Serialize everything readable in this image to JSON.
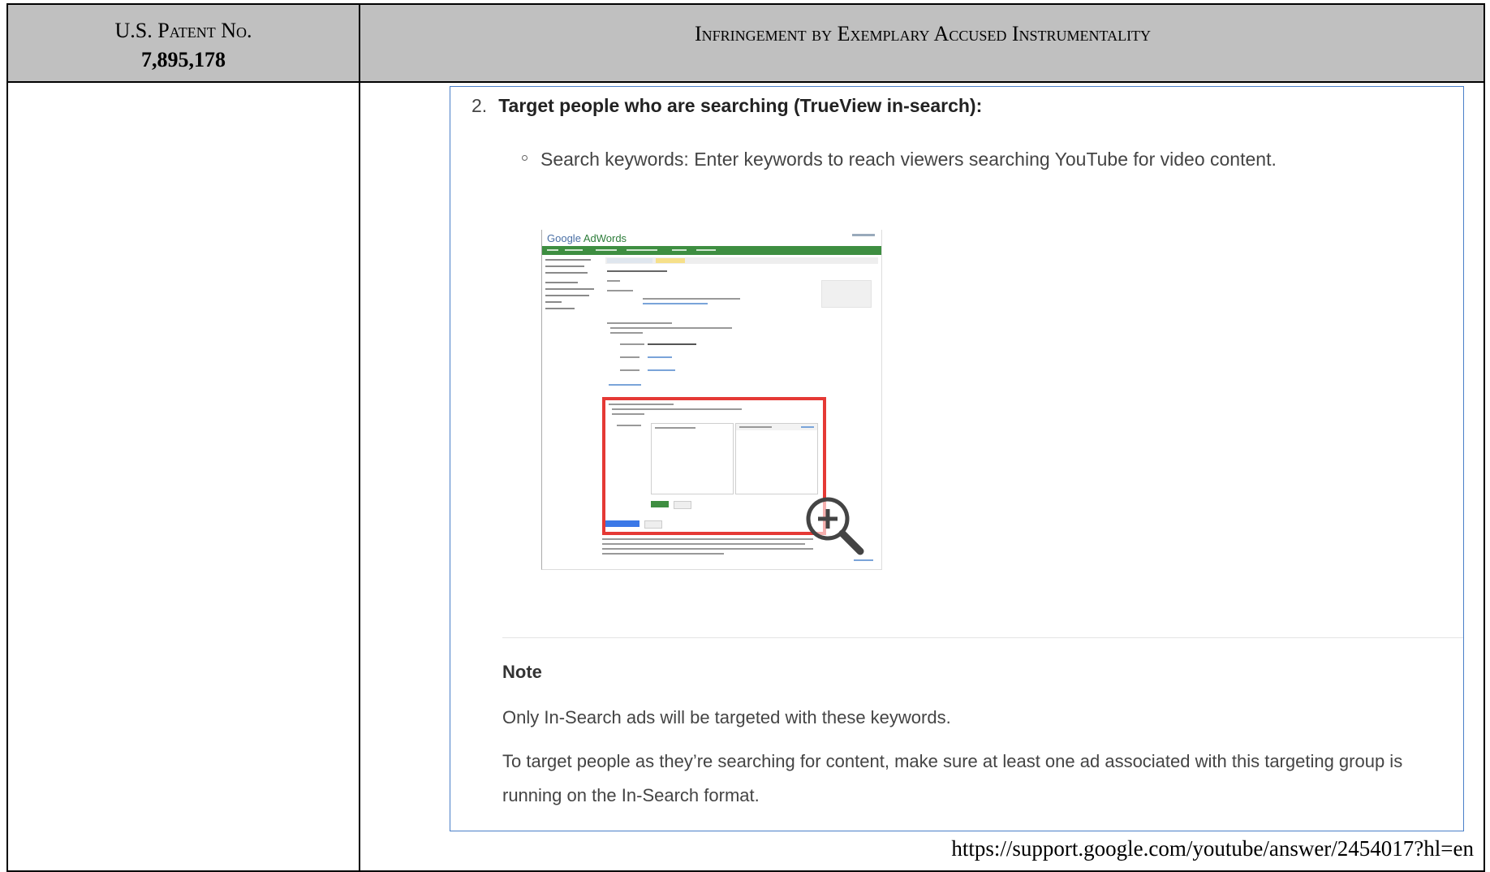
{
  "header": {
    "left_label": "U.S. Patent No.",
    "left_number": "7,895,178",
    "right_label": "Infringement by Exemplary Accused Instrumentality"
  },
  "content": {
    "step_number": "2.",
    "step_title": "Target people who are searching (TrueView in-search):",
    "bullet_text": "Search keywords: Enter keywords to reach viewers searching YouTube for video content.",
    "thumbnail": {
      "logo_google": "Google",
      "logo_adwords": "AdWords",
      "zoom_icon": "zoom-in-magnifier-icon",
      "highlight_color": "#e53935",
      "nav_color": "#3e8e41"
    },
    "note_heading": "Note",
    "note_line1": "Only In-Search ads will be targeted with these keywords.",
    "note_line2": "To target people as they’re searching for content, make sure at least one ad associated with this targeting group is running on the In-Search format."
  },
  "source_url": "https://support.google.com/youtube/answer/2454017?hl=en"
}
